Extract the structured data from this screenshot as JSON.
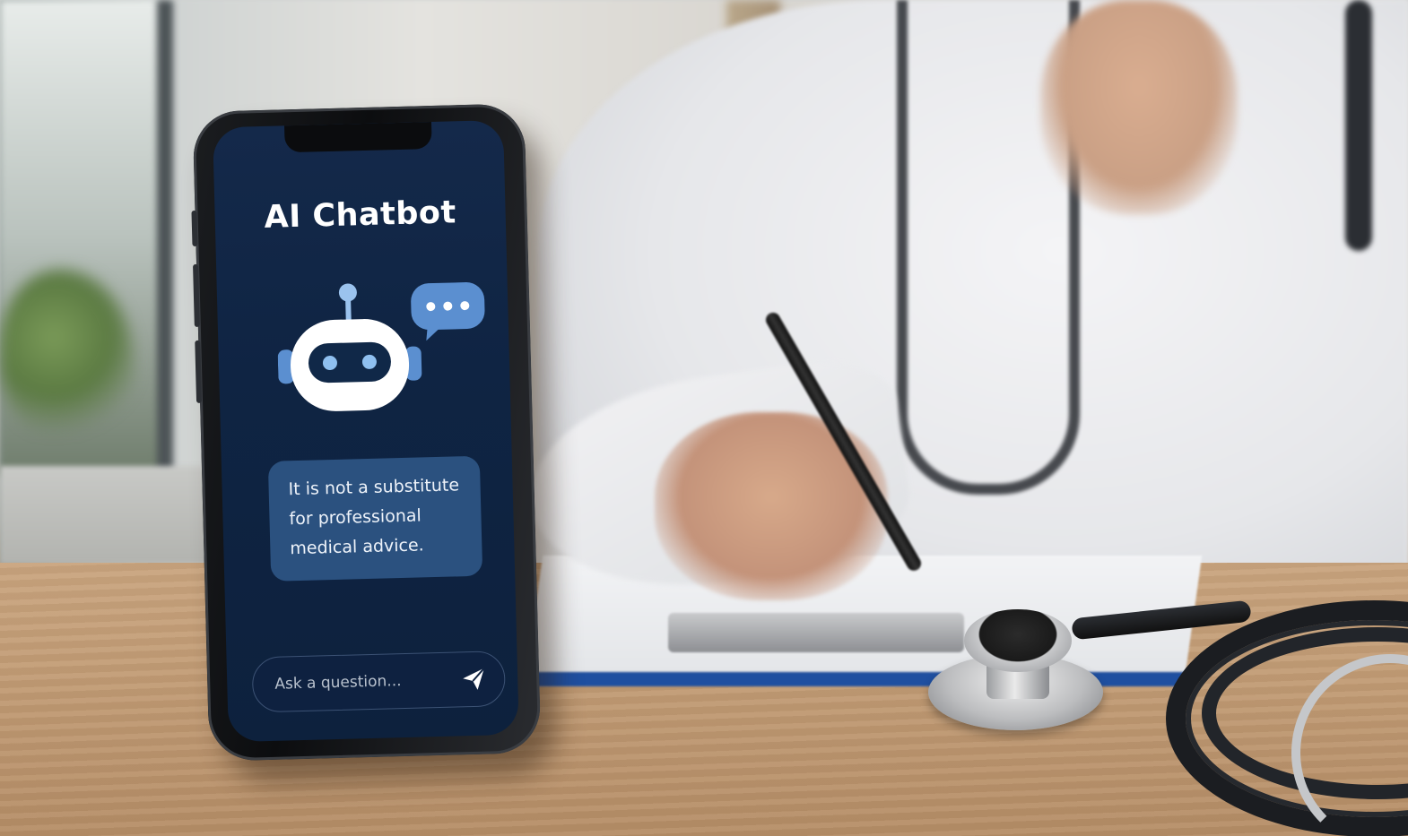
{
  "chatbot_app": {
    "title": "AI Chatbot",
    "message": "It is not a substitute for professional medical advice.",
    "input_placeholder": "Ask a question...",
    "icons": {
      "bot": "robot-icon",
      "speech": "speech-bubble-icon",
      "send": "paper-plane-icon"
    },
    "colors": {
      "screen_background": "#0f2443",
      "message_bubble": "#2b517f",
      "accent": "#5b8fd0"
    }
  }
}
